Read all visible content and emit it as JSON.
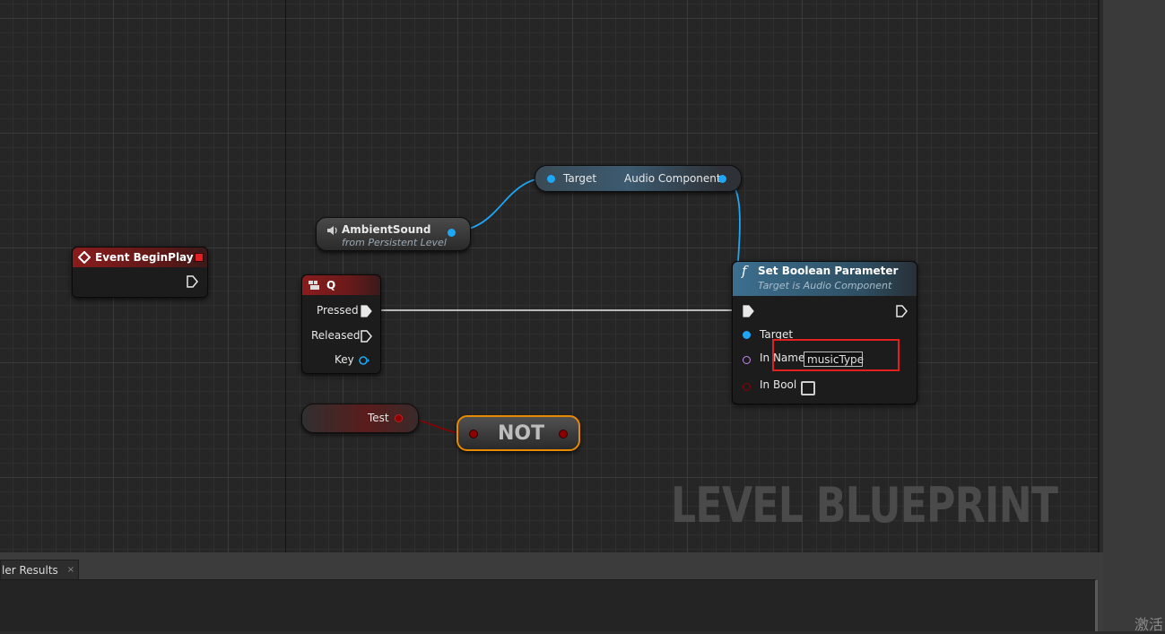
{
  "watermark": "LEVEL BLUEPRINT",
  "nodes": {
    "event_begin_play": {
      "title": "Event BeginPlay",
      "icon": "event-diamond-icon"
    },
    "ambient_sound": {
      "title": "AmbientSound",
      "subtitle": "from Persistent Level",
      "icon": "speaker-icon"
    },
    "key_q": {
      "title": "Q",
      "icon": "keyboard-icon",
      "pins": [
        "Pressed",
        "Released",
        "Key"
      ]
    },
    "test_var": {
      "label": "Test"
    },
    "not_node": {
      "label": "NOT"
    },
    "audio_getter": {
      "input": "Target",
      "output": "Audio Component"
    },
    "set_bool": {
      "title": "Set Boolean Parameter",
      "subtitle": "Target is Audio Component",
      "icon": "function-icon",
      "pins": {
        "target": "Target",
        "in_name": "In Name",
        "in_bool": "In Bool"
      },
      "in_name_value": "musicType"
    }
  },
  "bottom_panel": {
    "tab_label": "ler Results",
    "tab_close": "×"
  },
  "corner_text": "激活",
  "colors": {
    "object_pin": "#1ea7f5",
    "bool_pin": "#8c0000",
    "name_pin": "#c68af0",
    "event_header": "#8a1c1c",
    "highlight": "#e02020",
    "not_border": "#e88a00"
  }
}
